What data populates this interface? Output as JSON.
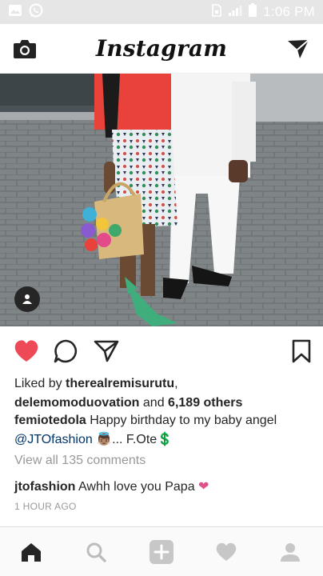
{
  "status_bar": {
    "time": "1:06 PM",
    "left_icons": [
      "image-icon",
      "whatsapp-icon"
    ],
    "right_icons": [
      "sim-icon",
      "signal-icon",
      "battery-icon"
    ]
  },
  "header": {
    "logo_text": "Instagram",
    "left_icon": "camera-icon",
    "right_icon": "send-icon"
  },
  "post": {
    "tag_icon": "user-tag-icon",
    "actions": [
      "heart-icon",
      "comment-icon",
      "share-icon",
      "bookmark-icon"
    ],
    "liked": true,
    "like_color": "#ed4956",
    "likes": {
      "prefix": "Liked by ",
      "user1": "therealremisurutu",
      "comma": ",",
      "user2": "delemomoduovation",
      "and": " and ",
      "others": "6,189 others"
    },
    "caption": {
      "username": "femiotedola",
      "text": " Happy birthday to my baby angel ",
      "mention": "@JTOfashion",
      "emoji1": "👼🏽",
      "tail": "... F.Ote",
      "emoji2": "💲"
    },
    "view_all_comments": "View all 135 comments",
    "comment": {
      "username": "jtofashion",
      "text": " Awhh love you Papa ",
      "emoji": "❤"
    },
    "time_ago": "1 HOUR AGO"
  },
  "bottom_nav": [
    "home-icon",
    "search-icon",
    "add-post-icon",
    "activity-icon",
    "profile-icon"
  ],
  "colors": {
    "mention": "#003569",
    "muted": "#999999",
    "status_bar": "#e6e6e6"
  }
}
